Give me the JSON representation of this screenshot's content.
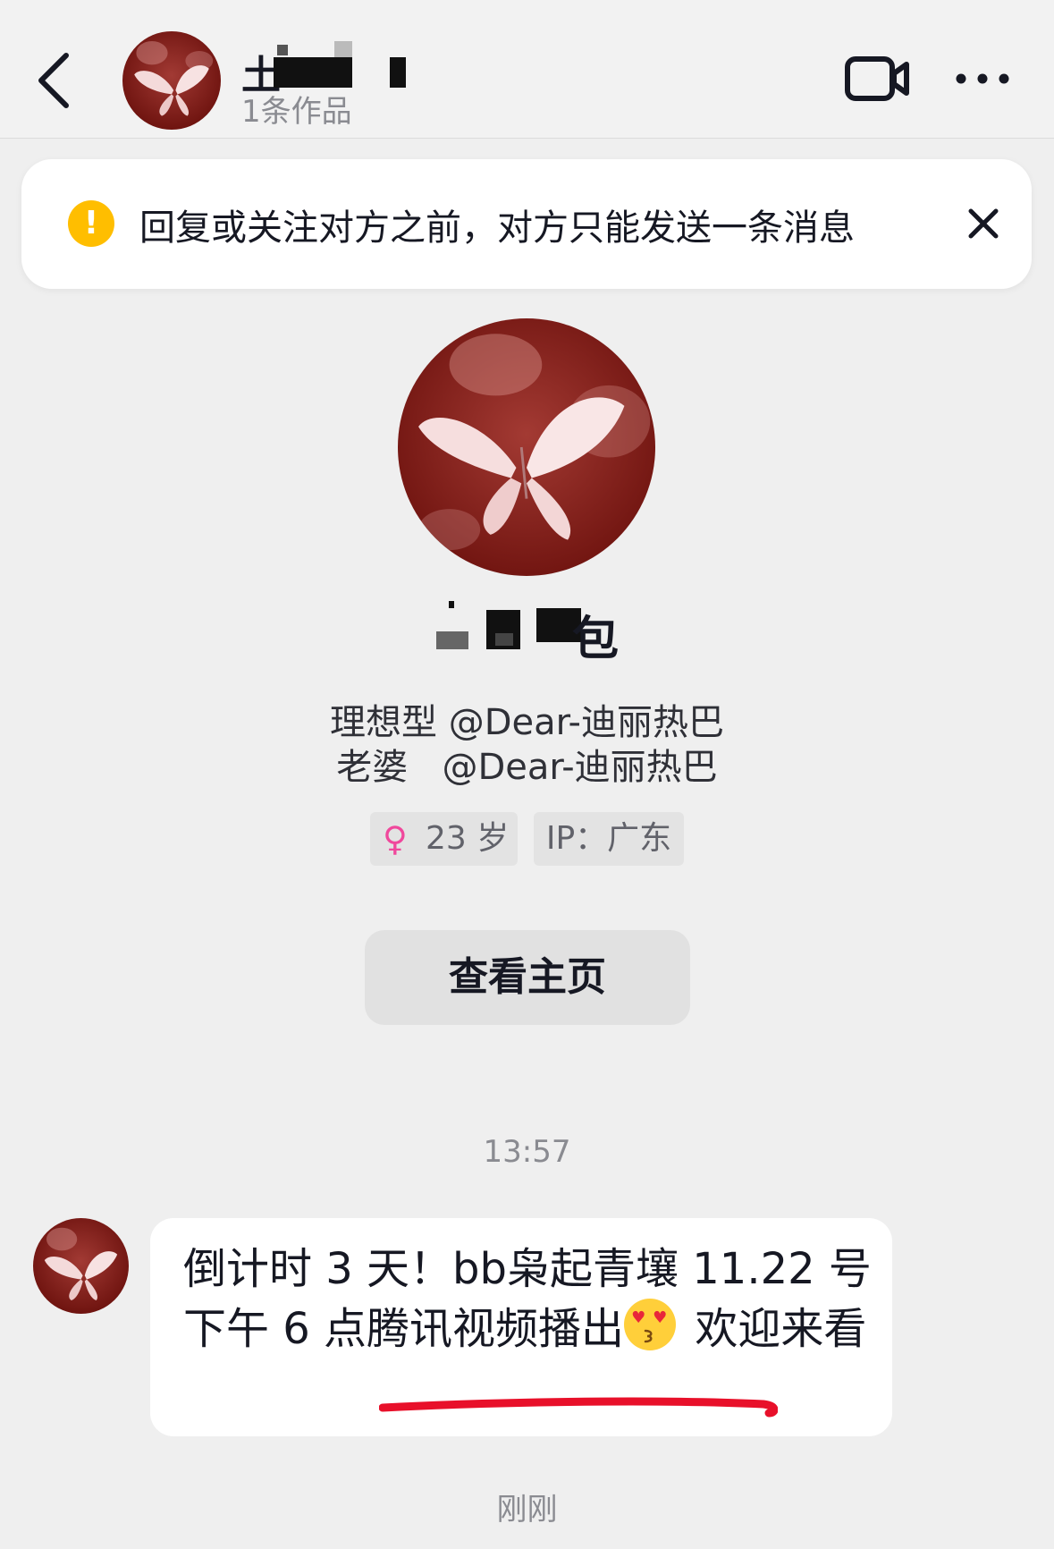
{
  "header": {
    "name_visible_char": "土",
    "subtitle": "1条作品",
    "icons": {
      "back": "chevron-left-icon",
      "video": "video-call-icon",
      "more": "more-icon"
    }
  },
  "notice": {
    "text": "回复或关注对方之前，对方只能发送一条消息",
    "icon": "warning-icon",
    "close_icon": "close-icon",
    "accent": "#ffbe00"
  },
  "profile": {
    "name_visible_char": "包",
    "bio_line1": "理想型 @Dear-迪丽热巴",
    "bio_line2": "老婆   @Dear-迪丽热巴",
    "tags": [
      {
        "symbol": "♀",
        "label": "23 岁",
        "symbol_color": "#f0489c"
      },
      {
        "label": "IP：广东"
      }
    ],
    "home_button": "查看主页"
  },
  "conversation": {
    "timestamp": "13:57",
    "message": {
      "part1": "倒计时 3 天！bb枭起青壤 11.22 号下午 6 点腾讯视频播出",
      "emoji": "heart-eyes-kiss-emoji",
      "part2": " 欢迎来看",
      "underline_color": "#e8102a"
    },
    "status": "刚刚"
  }
}
